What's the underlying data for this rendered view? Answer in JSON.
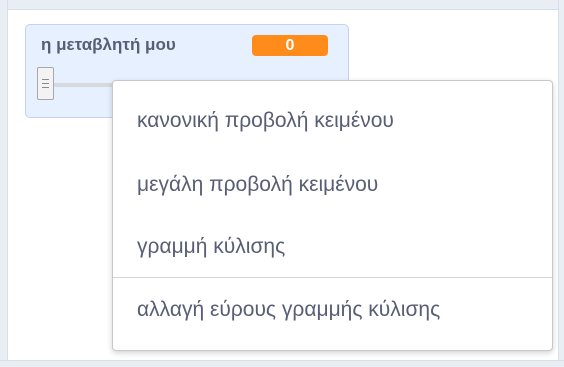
{
  "monitor": {
    "label": "η μεταβλητή μου",
    "value": "0",
    "slider_level": 0
  },
  "context_menu": {
    "items": [
      {
        "label": "κανονική προβολή κειμένου"
      },
      {
        "label": "μεγάλη προβολή κειμένου"
      },
      {
        "label": "γραμμή κύλισης"
      },
      {
        "label": "αλλαγή εύρους γραμμής κύλισης"
      }
    ]
  },
  "colors": {
    "value_badge": "#ff8c1a",
    "monitor_bg": "#e6f0ff",
    "text": "#575e75"
  }
}
